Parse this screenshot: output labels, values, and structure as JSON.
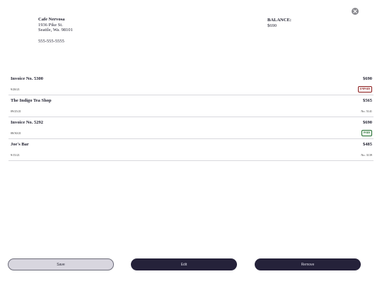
{
  "vendor": {
    "name": "Cafe Nervosa",
    "address_line1": "1936 Pike St.",
    "address_line2": "Seattle, Wa. 98101",
    "phone": "555-555-5555"
  },
  "balance": {
    "label": "BALANCE:",
    "value": "$690"
  },
  "rows": [
    {
      "title": "Invoice No. 5300",
      "amount": "$690",
      "date": "9/28/21",
      "badge": "UNPAID",
      "status": "unpaid"
    },
    {
      "title": "The Indigo Tea Shop",
      "amount": "$565",
      "date": "09/25/21",
      "ref": "No. 5141"
    },
    {
      "title": "Invoice No. 5292",
      "amount": "$690",
      "date": "08/30/21",
      "badge": "PAID",
      "status": "paid"
    },
    {
      "title": "Joe's Bar",
      "amount": "$485",
      "date": "9/15/21",
      "ref": "No. 3139"
    }
  ],
  "buttons": {
    "save": "Save",
    "edit": "Edit",
    "remove": "Remove"
  },
  "icons": {
    "close": "close-icon"
  },
  "colors": {
    "primary_button": "#25223a",
    "secondary_button": "#d8d6df",
    "unpaid": "#8b1a1a",
    "paid": "#1d6b2a"
  }
}
